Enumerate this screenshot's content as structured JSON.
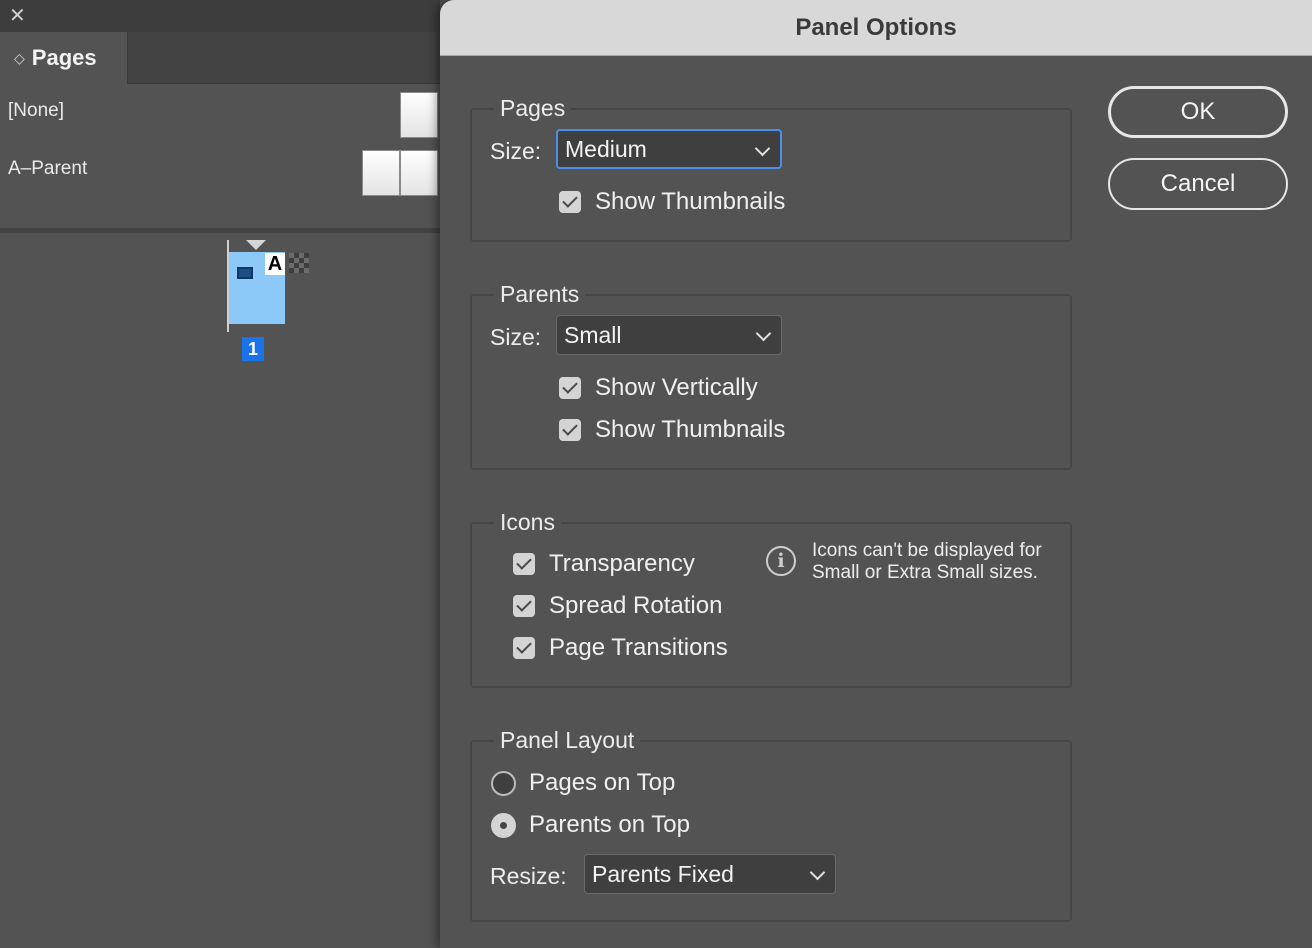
{
  "left_panel": {
    "close_symbol": "✕",
    "tab_arrows": "◇",
    "tab_label": "Pages",
    "parents": [
      {
        "label": "[None]"
      },
      {
        "label": "A–Parent"
      }
    ],
    "page": {
      "parent_prefix": "A",
      "number": "1",
      "color": "#8cc8f8",
      "selected_number_color": "#1a73e8"
    }
  },
  "dialog": {
    "title": "Panel Options",
    "buttons": {
      "ok": "OK",
      "cancel": "Cancel"
    },
    "pages_group": {
      "legend": "Pages",
      "size_label": "Size:",
      "size_value": "Medium",
      "show_thumbnails": {
        "label": "Show Thumbnails",
        "checked": true
      }
    },
    "parents_group": {
      "legend": "Parents",
      "size_label": "Size:",
      "size_value": "Small",
      "show_vertically": {
        "label": "Show Vertically",
        "checked": true
      },
      "show_thumbnails": {
        "label": "Show Thumbnails",
        "checked": true
      }
    },
    "icons_group": {
      "legend": "Icons",
      "transparency": {
        "label": "Transparency",
        "checked": true
      },
      "spread_rotation": {
        "label": "Spread Rotation",
        "checked": true
      },
      "page_transitions": {
        "label": "Page Transitions",
        "checked": true
      },
      "info_icon": "i",
      "note": "Icons can't be displayed for Small or Extra Small sizes."
    },
    "layout_group": {
      "legend": "Panel Layout",
      "pages_on_top": {
        "label": "Pages on Top",
        "selected": false
      },
      "parents_on_top": {
        "label": "Parents on Top",
        "selected": true
      },
      "resize_label": "Resize:",
      "resize_value": "Parents Fixed"
    }
  },
  "colors": {
    "panel_bg": "#535353",
    "titlebar_bg": "#d8d8d8",
    "focus_ring": "#4b8fe8"
  }
}
